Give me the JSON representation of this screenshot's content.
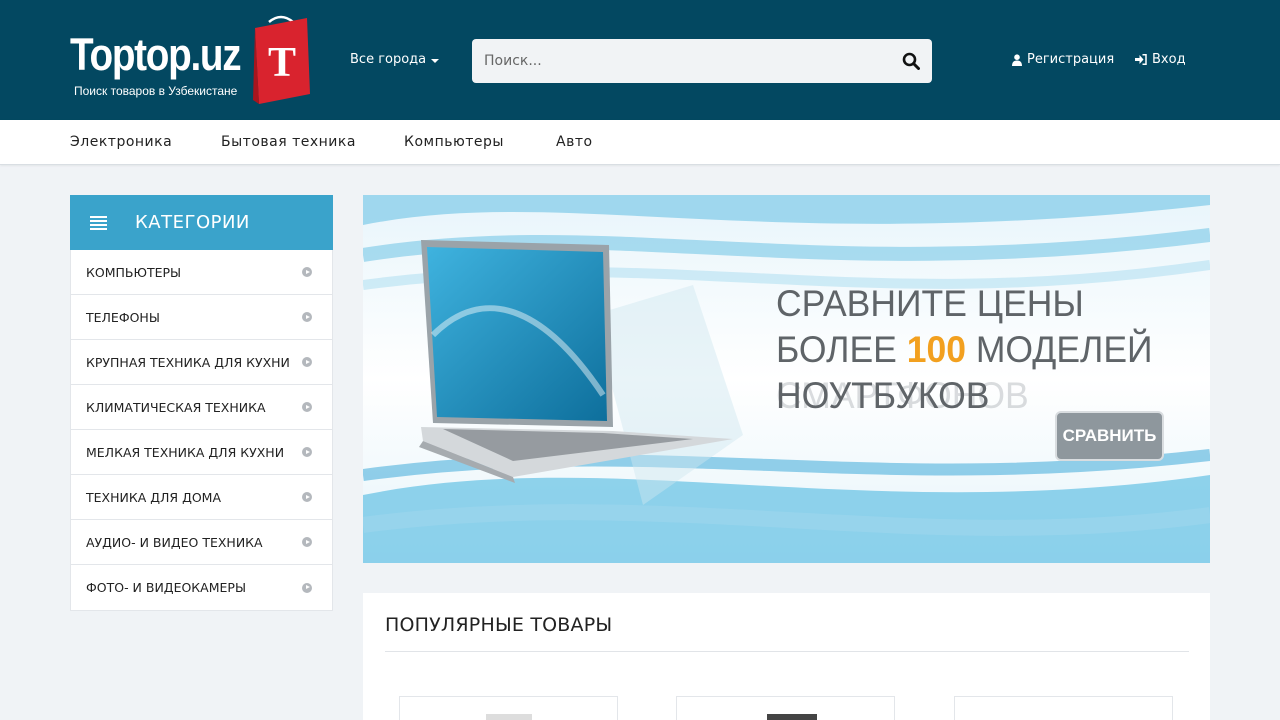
{
  "header": {
    "logo_text": "Toptop.uz",
    "logo_subtitle": "Поиск товаров в Узбекистане",
    "logo_bag_letter": "T",
    "city_label": "Все города",
    "search_placeholder": "Поиск...",
    "register_label": "Регистрация",
    "login_label": "Вход"
  },
  "nav": {
    "items": [
      "Электроника",
      "Бытовая техника",
      "Компьютеры",
      "Авто"
    ]
  },
  "sidebar": {
    "title": "КАТЕГОРИИ",
    "items": [
      "КОМПЬЮТЕРЫ",
      "ТЕЛЕФОНЫ",
      "КРУПНАЯ ТЕХНИКА ДЛЯ КУХНИ",
      "КЛИМАТИЧЕСКАЯ ТЕХНИКА",
      "МЕЛКАЯ ТЕХНИКА ДЛЯ КУХНИ",
      "ТЕХНИКА ДЛЯ ДОМА",
      "АУДИО- И ВИДЕО ТЕХНИКА",
      "ФОТО- И ВИДЕОКАМЕРЫ"
    ]
  },
  "banner": {
    "line1": "СРАВНИТЕ ЦЕНЫ",
    "line2_before": "БОЛЕЕ ",
    "line2_number": "100",
    "line2_after": " МОДЕЛЕЙ",
    "line3": "НОУТБУКОВ",
    "ghost_text": "СМАРТФОНОВ",
    "button_label": "СРАВНИТЬ",
    "accent_color": "#f2a01f"
  },
  "popular": {
    "title": "ПОПУЛЯРНЫЕ ТОВАРЫ",
    "card_count": 3
  },
  "colors": {
    "header_bg": "#034861",
    "category_header_bg": "#3aa3cb",
    "logo_bag_red": "#d9232e",
    "page_bg": "#f0f3f6"
  },
  "icons": {
    "search": "search-icon",
    "register": "user-icon",
    "login": "sign-in-icon",
    "categories": "bars-icon",
    "category_arrow": "circle-arrow-right-icon"
  }
}
